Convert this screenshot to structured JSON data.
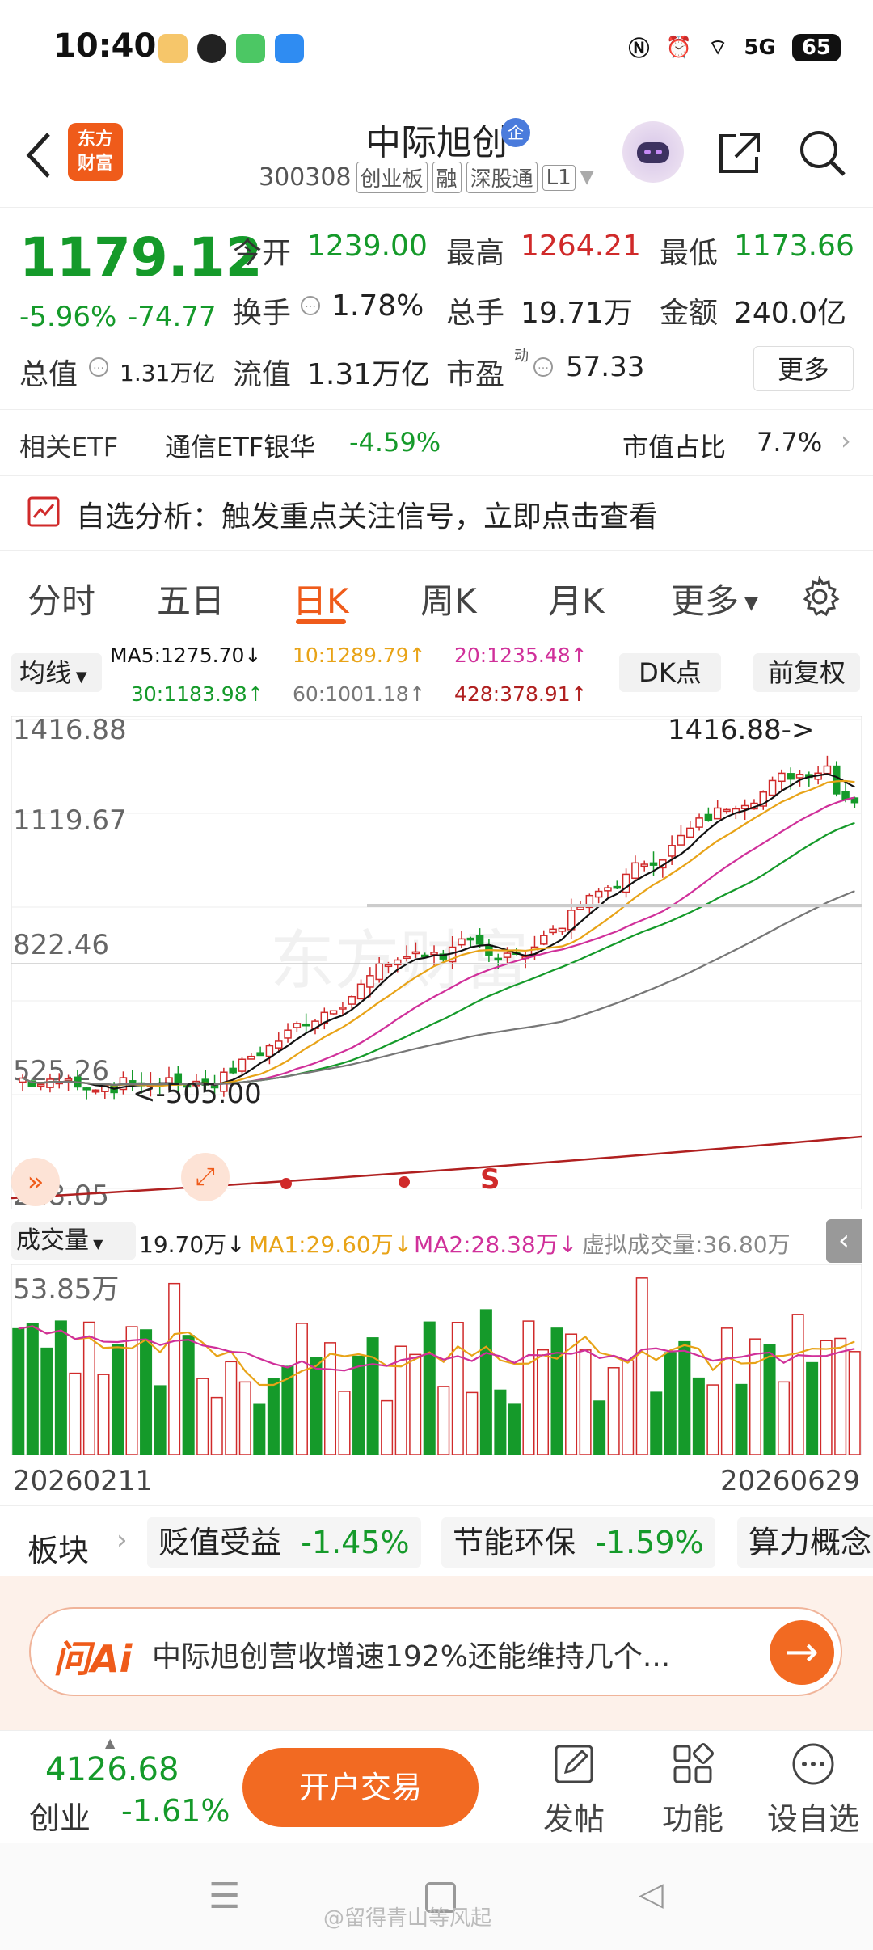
{
  "status_bar": {
    "time": "10:40",
    "network": "5G",
    "battery": "65"
  },
  "header": {
    "stock_name": "中际旭创",
    "badge": "企",
    "code": "300308",
    "tags": [
      "创业板",
      "融",
      "深股通",
      "L1"
    ],
    "logo_text_line1": "东方",
    "logo_text_line2": "财富"
  },
  "quote": {
    "price": "1179.12",
    "change_pct": "-5.96%",
    "change": "-74.77",
    "open_label": "今开",
    "open": "1239.00",
    "high_label": "最高",
    "high": "1264.21",
    "low_label": "最低",
    "low": "1173.66",
    "turnover_label": "换手",
    "turnover": "1.78%",
    "volume_label": "总手",
    "volume": "19.71万",
    "amount_label": "金额",
    "amount": "240.0亿",
    "mktcap_label": "总值",
    "mktcap": "1.31万亿",
    "float_label": "流值",
    "float": "1.31万亿",
    "pe_label": "市盈",
    "pe_sup": "动",
    "pe": "57.33",
    "more_label": "更多"
  },
  "etf": {
    "label": "相关ETF",
    "name": "通信ETF银华",
    "pct": "-4.59%",
    "share_label": "市值占比",
    "share": "7.7%"
  },
  "analysis": {
    "text": "自选分析：触发重点关注信号，立即点击查看"
  },
  "tabs": [
    "分时",
    "五日",
    "日K",
    "周K",
    "月K",
    "更多"
  ],
  "active_tab": 2,
  "ma_bar": {
    "btn": "均线",
    "ma5": "MA5:1275.70↓",
    "ma10": "10:1289.79↑",
    "ma20": "20:1235.48↑",
    "ma30": "30:1183.98↑",
    "ma60": "60:1001.18↑",
    "ma428": "428:378.91↑",
    "dk_btn": "DK点",
    "fq_btn": "前复权"
  },
  "kline": {
    "y_labels": [
      "1416.88",
      "1119.67",
      "822.46",
      "525.26",
      "228.05"
    ],
    "high_marker": "1416.88->",
    "low_marker": "<-505.00",
    "s_marker": "S",
    "watermark": "东方财富",
    "colors": {
      "up": "#d02a2a",
      "down": "#159a2a",
      "ma5": "#111111",
      "ma10": "#e8a317",
      "ma20": "#d0309a",
      "ma30": "#159a2a",
      "ma60": "#777777",
      "ma428": "#b02020"
    }
  },
  "volume": {
    "btn": "成交量",
    "value": "19.70万↓",
    "ma1": "MA1:29.60万↓",
    "ma2": "MA2:28.38万↓",
    "virtual": "虚拟成交量:36.80万",
    "y_label": "53.85万"
  },
  "dates": {
    "start": "20260211",
    "end": "20260629"
  },
  "sectors": {
    "label": "板块",
    "items": [
      {
        "name": "贬值受益",
        "pct": "-1.45%"
      },
      {
        "name": "节能环保",
        "pct": "-1.59%"
      },
      {
        "name": "算力概念",
        "pct": ""
      }
    ]
  },
  "ai": {
    "brand": "问Ai",
    "question": "中际旭创营收增速192%还能维持几个..."
  },
  "bottom": {
    "index_value": "4126.68",
    "index_name": "创业",
    "index_pct": "-1.61%",
    "trade_btn": "开户交易",
    "post": "发帖",
    "func": "功能",
    "watch": "设自选"
  },
  "watermark_bottom": "@留得青山等风起"
}
